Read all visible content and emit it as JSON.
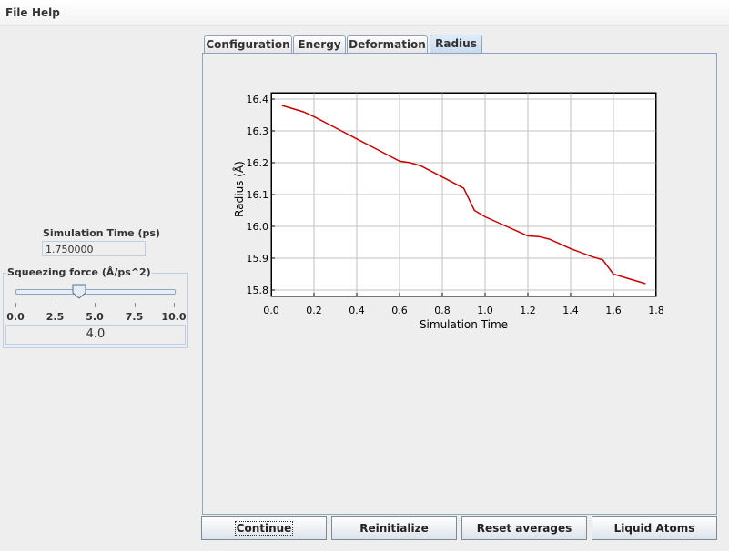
{
  "menu": {
    "file": "File",
    "help": "Help"
  },
  "sim_time": {
    "label": "Simulation Time (ps)",
    "value": "1.750000"
  },
  "force": {
    "title": "Squeezing force (Å/ps^2)",
    "ticks": [
      "0.0",
      "2.5",
      "5.0",
      "7.5",
      "10.0"
    ],
    "value_text": "4.0",
    "slider_value": 4.0,
    "slider_min": 0.0,
    "slider_max": 10.0
  },
  "tabs": [
    {
      "label": "Configuration",
      "selected": false
    },
    {
      "label": "Energy",
      "selected": false
    },
    {
      "label": "Deformation",
      "selected": false
    },
    {
      "label": "Radius",
      "selected": true
    }
  ],
  "buttons": {
    "continue": "Continue",
    "reinitialize": "Reinitialize",
    "reset": "Reset averages",
    "liquid": "Liquid Atoms"
  },
  "colors": {
    "series": "#cc0000",
    "grid": "#c0c0c0",
    "accent_border": "#8da4c1"
  },
  "chart_data": {
    "type": "line",
    "title": "",
    "xlabel": "Simulation Time",
    "ylabel": "Radius (Å)",
    "xlim": [
      0.0,
      1.8
    ],
    "ylim": [
      15.78,
      16.42
    ],
    "xticks": [
      "0.0",
      "0.2",
      "0.4",
      "0.6",
      "0.8",
      "1.0",
      "1.2",
      "1.4",
      "1.6",
      "1.8"
    ],
    "yticks": [
      "15.8",
      "15.9",
      "16.0",
      "16.1",
      "16.2",
      "16.3",
      "16.4"
    ],
    "grid": true,
    "series": [
      {
        "x": [
          0.05,
          0.1,
          0.15,
          0.2,
          0.3,
          0.4,
          0.5,
          0.6,
          0.65,
          0.7,
          0.8,
          0.9,
          0.95,
          1.0,
          1.1,
          1.2,
          1.25,
          1.3,
          1.4,
          1.5,
          1.55,
          1.6,
          1.7,
          1.75
        ],
        "y": [
          16.38,
          16.37,
          16.36,
          16.345,
          16.31,
          16.275,
          16.24,
          16.205,
          16.2,
          16.19,
          16.155,
          16.12,
          16.05,
          16.03,
          16.0,
          15.97,
          15.968,
          15.96,
          15.93,
          15.905,
          15.895,
          15.85,
          15.83,
          15.82
        ]
      }
    ]
  }
}
